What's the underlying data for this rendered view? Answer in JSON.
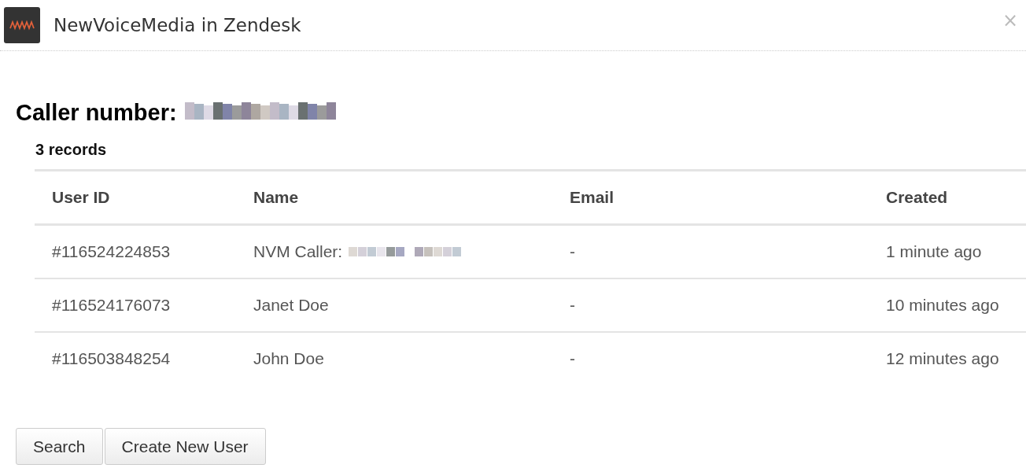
{
  "window": {
    "title": "NewVoiceMedia in Zendesk",
    "close": "×"
  },
  "caller": {
    "label": "Caller number:",
    "redacted": true
  },
  "record_count": "3 records",
  "table": {
    "columns": [
      "User ID",
      "Name",
      "Email",
      "Created"
    ],
    "rows": [
      {
        "user_id": "#116524224853",
        "name": "NVM Caller:",
        "name_redacted": true,
        "email": "-",
        "created": "1 minute ago"
      },
      {
        "user_id": "#116524176073",
        "name": "Janet Doe",
        "name_redacted": false,
        "email": "-",
        "created": "10 minutes ago"
      },
      {
        "user_id": "#116503848254",
        "name": "John Doe",
        "name_redacted": false,
        "email": "-",
        "created": "12 minutes ago"
      }
    ]
  },
  "buttons": [
    "Search",
    "Create New User"
  ]
}
